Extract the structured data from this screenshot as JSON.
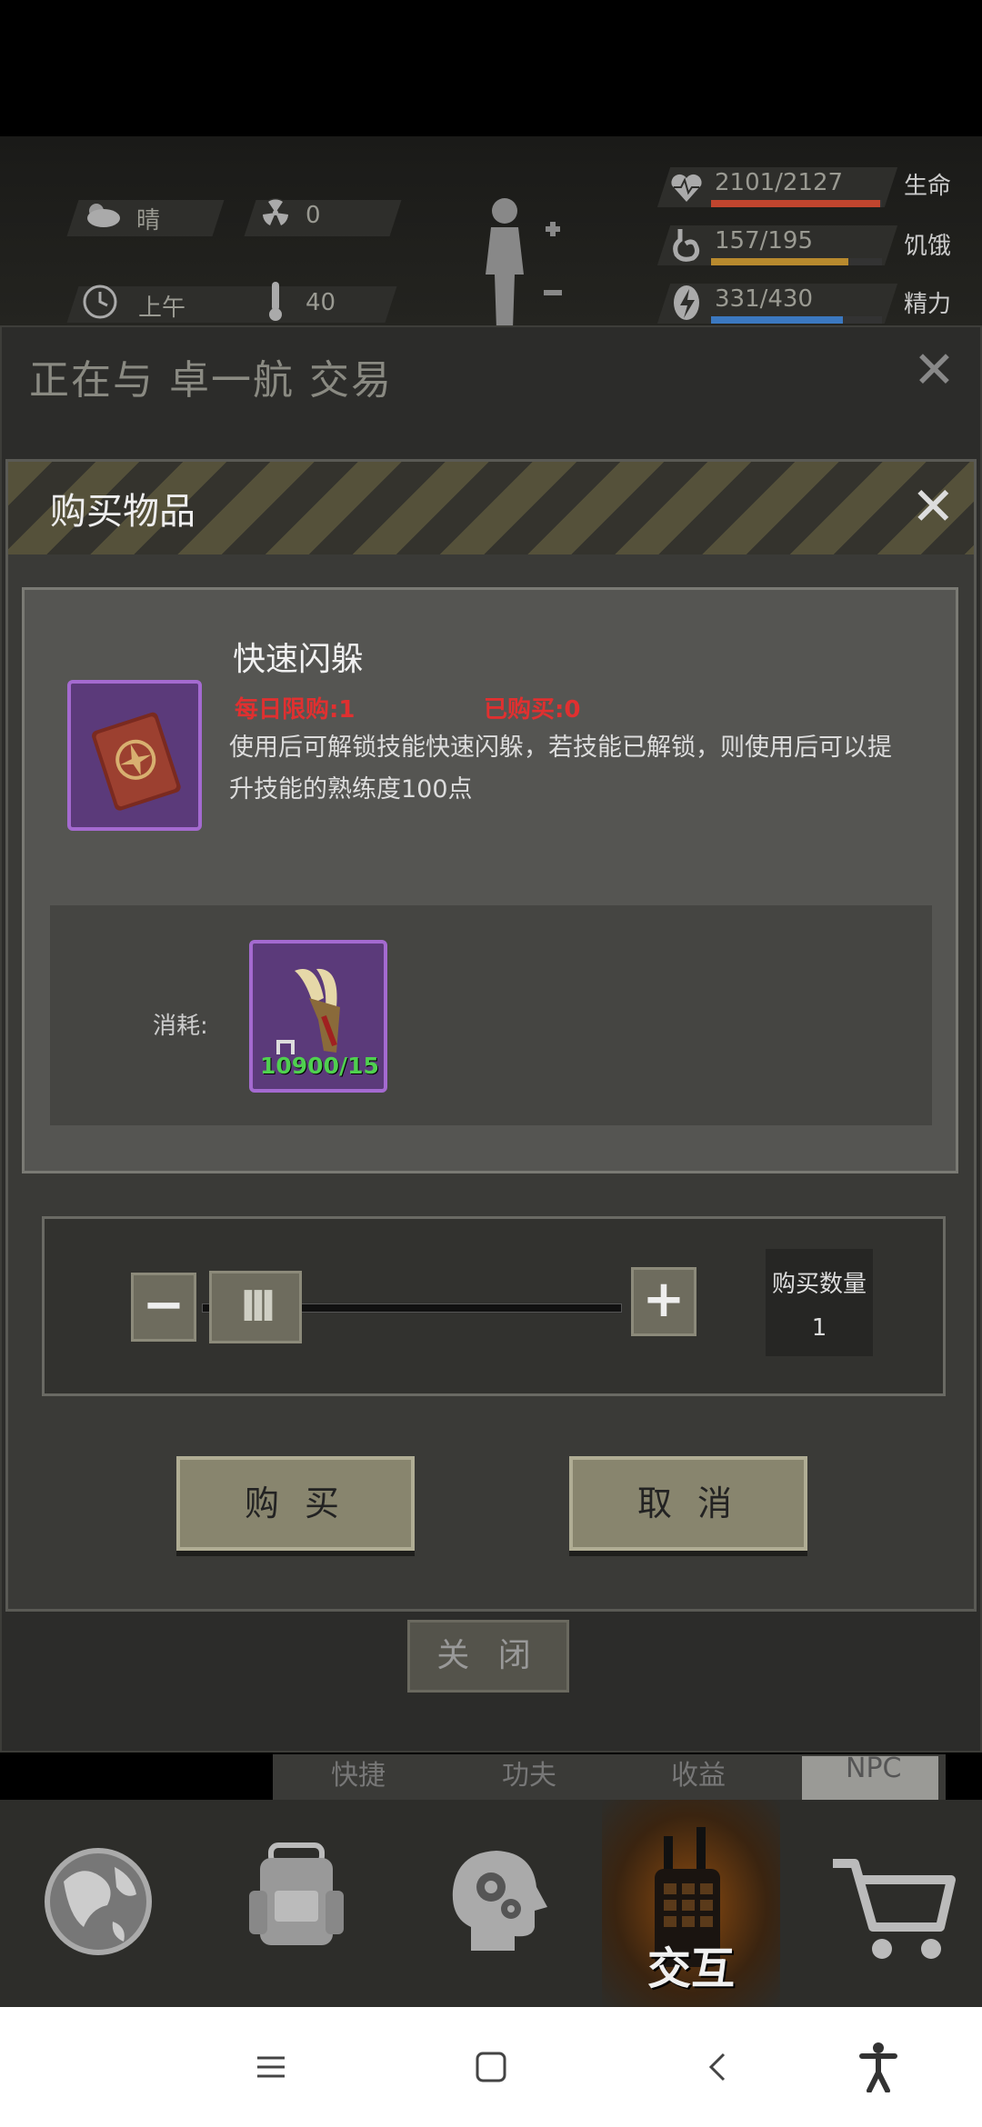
{
  "status_bar": {
    "weather": "晴",
    "radiation": "0",
    "time_of_day": "上午",
    "temperature": "40",
    "health": {
      "value": "2101/2127",
      "label": "生命",
      "fraction": 0.988,
      "color": "#c0452e"
    },
    "hunger": {
      "value": "157/195",
      "label": "饥饿",
      "fraction": 0.805,
      "color": "#b88a2e"
    },
    "energy": {
      "value": "331/430",
      "label": "精力",
      "fraction": 0.77,
      "color": "#3b78c0"
    }
  },
  "trade_dialog": {
    "title": "正在与 卓一航 交易",
    "close_label": "关 闭"
  },
  "buy_dialog": {
    "title": "购买物品",
    "item": {
      "name": "快速闪躲",
      "daily_limit": "每日限购:1",
      "bought": "已购买:0",
      "description": "使用后可解锁技能快速闪躲，若技能已解锁，则使用后可以提升技能的熟练度100点"
    },
    "cost": {
      "label": "消耗:",
      "count": "10900/15"
    },
    "quantity": {
      "label": "购买数量",
      "value": "1"
    },
    "buy_label": "购 买",
    "cancel_label": "取 消"
  },
  "underlying_tabs": [
    "快捷",
    "功夫",
    "收益",
    "NPC"
  ],
  "bottom_nav": {
    "active_label": "交互",
    "items": [
      "globe-icon",
      "backpack-icon",
      "brain-icon",
      "walkie-talkie-icon",
      "cart-icon"
    ]
  }
}
